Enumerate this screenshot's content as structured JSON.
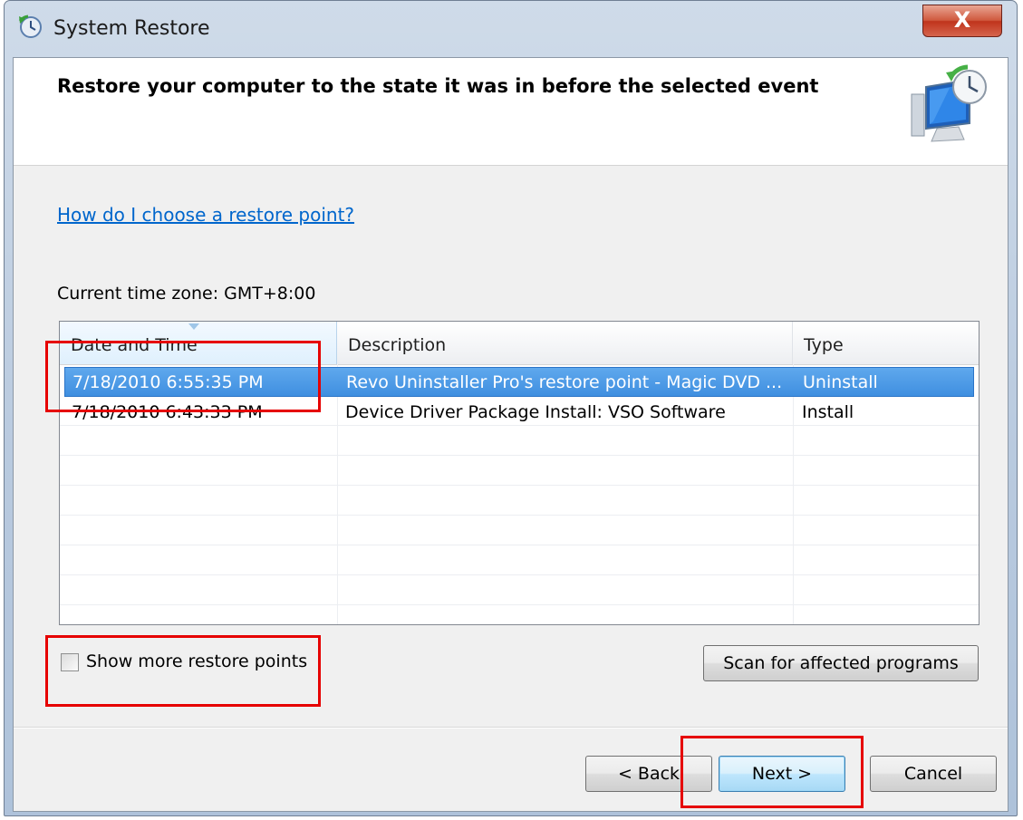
{
  "window": {
    "title": "System Restore",
    "close_label": "X"
  },
  "header": {
    "title": "Restore your computer to the state it was in before the selected event",
    "icon": "system-restore-monitor-icon"
  },
  "help_link": "How do I choose a restore point?",
  "timezone_label": "Current time zone: GMT+8:00",
  "table": {
    "columns": [
      "Date and Time",
      "Description",
      "Type"
    ],
    "rows": [
      {
        "date": "7/18/2010 6:55:35 PM",
        "description": "Revo Uninstaller Pro's restore point - Magic DVD ...",
        "type": "Uninstall",
        "selected": true
      },
      {
        "date": "7/18/2010 6:43:33 PM",
        "description": "Device Driver Package Install: VSO Software",
        "type": "Install",
        "selected": false
      }
    ]
  },
  "show_more": {
    "label": "Show more restore points",
    "checked": false
  },
  "buttons": {
    "scan": "Scan for affected programs",
    "back": "< Back",
    "next": "Next >",
    "cancel": "Cancel"
  },
  "colors": {
    "highlight": "#e60000",
    "selection": "#3f8fe0",
    "link": "#0066cc"
  }
}
